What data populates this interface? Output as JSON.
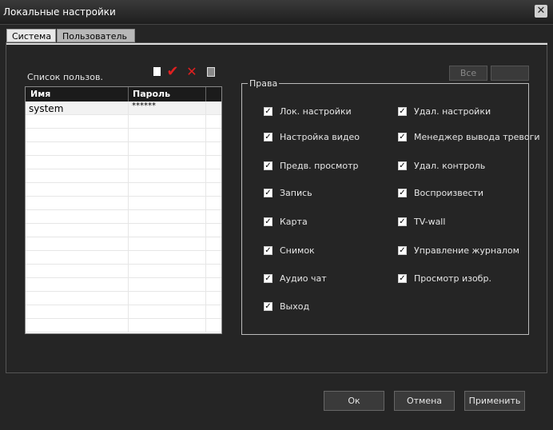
{
  "window": {
    "title": "Локальные настройки",
    "close_glyph": "✕"
  },
  "tabs": [
    {
      "label": "Система",
      "active": true
    },
    {
      "label": "Пользователь",
      "active": false
    }
  ],
  "users": {
    "list_label": "Список пользов.",
    "toolbar_icons": [
      "new-user-icon",
      "confirm-icon",
      "delete-icon",
      "paste-icon"
    ],
    "columns": [
      "Имя",
      "Пароль"
    ],
    "rows": [
      {
        "name": "system",
        "password": "******"
      }
    ]
  },
  "top_buttons": {
    "all_label": "Все",
    "blank_label": ""
  },
  "rights": {
    "title": "Права",
    "left": [
      {
        "label": "Лок. настройки",
        "checked": true
      },
      {
        "label": "Настройка видео",
        "checked": true
      },
      {
        "label": "Предв. просмотр",
        "checked": true
      },
      {
        "label": "Запись",
        "checked": true
      },
      {
        "label": "Карта",
        "checked": true
      },
      {
        "label": "Снимок",
        "checked": true
      },
      {
        "label": "Аудио чат",
        "checked": true
      },
      {
        "label": "Выход",
        "checked": true
      }
    ],
    "right": [
      {
        "label": "Удал. настройки",
        "checked": true
      },
      {
        "label": "Менеджер вывода тревоги",
        "checked": true
      },
      {
        "label": "Удал. контроль",
        "checked": true
      },
      {
        "label": "Воспроизвести",
        "checked": true
      },
      {
        "label": "TV-wall",
        "checked": true
      },
      {
        "label": "Управление журналом",
        "checked": true
      },
      {
        "label": "Просмотр изобр.",
        "checked": true
      }
    ]
  },
  "footer": {
    "ok_label": "Ок",
    "cancel_label": "Отмена",
    "apply_label": "Применить"
  }
}
